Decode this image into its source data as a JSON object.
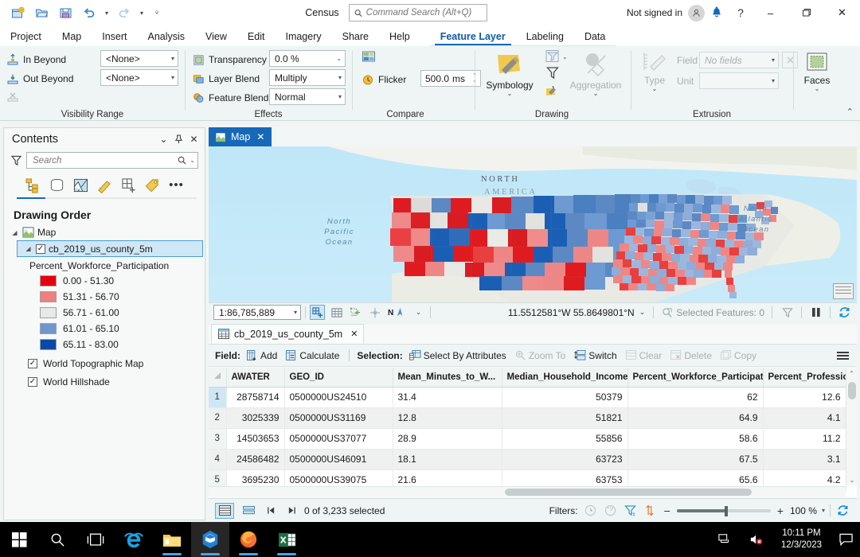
{
  "titlebar": {
    "project_name": "Census",
    "search_placeholder": "Command Search (Alt+Q)",
    "sign_in_text": "Not signed in",
    "quick_access": [
      "new-project-icon",
      "open-project-icon",
      "save-project-icon",
      "undo-icon",
      "redo-icon",
      "customize-qat-icon"
    ],
    "help_label": "?",
    "minimize_label": "–",
    "restore_label": "❐",
    "close_label": "✕"
  },
  "ribbon_tabs": {
    "main": [
      "Project",
      "Map",
      "Insert",
      "Analysis",
      "View",
      "Edit",
      "Imagery",
      "Share",
      "Help"
    ],
    "contextual": [
      "Feature Layer",
      "Labeling",
      "Data"
    ],
    "active": "Feature Layer"
  },
  "ribbon": {
    "groups": [
      {
        "name": "Visibility Range"
      },
      {
        "name": "Effects"
      },
      {
        "name": "Compare"
      },
      {
        "name": "Drawing"
      },
      {
        "name": "Extrusion"
      },
      {
        "name": ""
      }
    ],
    "visibility": {
      "in_beyond_label": "In Beyond",
      "in_beyond_value": "<None>",
      "out_beyond_label": "Out Beyond",
      "out_beyond_value": "<None>"
    },
    "effects": {
      "transparency_label": "Transparency",
      "transparency_value": "0.0 %",
      "layer_blend_label": "Layer Blend",
      "layer_blend_value": "Multiply",
      "feature_blend_label": "Feature Blend",
      "feature_blend_value": "Normal"
    },
    "compare": {
      "flicker_label": "Flicker",
      "flicker_value": "500.0",
      "flicker_unit": "ms"
    },
    "drawing": {
      "symbology_label": "Symbology",
      "aggregation_label": "Aggregation"
    },
    "extrusion": {
      "type_label": "Type",
      "field_label": "Field",
      "field_value": "No fields",
      "unit_label": "Unit",
      "unit_value": ""
    },
    "faces": {
      "label": "Faces"
    }
  },
  "contents": {
    "title": "Contents",
    "search_placeholder": "Search",
    "drawing_order_label": "Drawing Order",
    "map_node": "Map",
    "layer_name": "cb_2019_us_county_5m",
    "symbology_field": "Percent_Workforce_Participation",
    "legend": [
      {
        "label": "0.00 - 51.30",
        "color": "#e8000d"
      },
      {
        "label": "51.31 - 56.70",
        "color": "#ef8080"
      },
      {
        "label": "56.71 - 61.00",
        "color": "#e8e8e8"
      },
      {
        "label": "61.01 - 65.10",
        "color": "#6f97cd"
      },
      {
        "label": "65.11 - 83.00",
        "color": "#0b49a8"
      }
    ],
    "basemaps": [
      {
        "label": "World Topographic Map",
        "checked": true
      },
      {
        "label": "World Hillshade",
        "checked": true
      }
    ]
  },
  "map": {
    "tab_label": "Map",
    "scale": "1:86,785,889",
    "coordinates": "11.5512581°W 55.8649801°N",
    "selected_features": "Selected Features: 0",
    "labels": {
      "north_pacific": "North\nPacific\nOcean",
      "north_atlantic": "North\nAtlantic\nOcean",
      "continent": "NORTH",
      "continent2": "AMERICA"
    }
  },
  "table": {
    "tab_label": "cb_2019_us_county_5m",
    "toolbar": {
      "field_label": "Field:",
      "add_label": "Add",
      "calculate_label": "Calculate",
      "selection_label": "Selection:",
      "select_by_attributes_label": "Select By Attributes",
      "zoom_to_label": "Zoom To",
      "switch_label": "Switch",
      "clear_label": "Clear",
      "delete_label": "Delete",
      "copy_label": "Copy"
    },
    "columns": [
      "AWATER",
      "GEO_ID",
      "Mean_Minutes_to_W...",
      "Median_Household_Income",
      "Percent_Workforce_Participation",
      "Percent_Professional"
    ],
    "rows": [
      {
        "n": "1",
        "awater": "28758714",
        "geoid": "0500000US24510",
        "mean_minutes": "31.4",
        "income": "50379",
        "workforce": "62",
        "professional": "12.6"
      },
      {
        "n": "2",
        "awater": "3025339",
        "geoid": "0500000US31169",
        "mean_minutes": "12.8",
        "income": "51821",
        "workforce": "64.9",
        "professional": "4.1"
      },
      {
        "n": "3",
        "awater": "14503653",
        "geoid": "0500000US37077",
        "mean_minutes": "28.9",
        "income": "55856",
        "workforce": "58.6",
        "professional": "11.2"
      },
      {
        "n": "4",
        "awater": "24586482",
        "geoid": "0500000US46091",
        "mean_minutes": "18.1",
        "income": "63723",
        "workforce": "67.5",
        "professional": "3.1"
      },
      {
        "n": "5",
        "awater": "3695230",
        "geoid": "0500000US39075",
        "mean_minutes": "21.6",
        "income": "63753",
        "workforce": "65.6",
        "professional": "4.2"
      }
    ],
    "footer": {
      "selection_status": "0 of 3,233 selected",
      "filters_label": "Filters:",
      "zoom_percent": "100 %"
    }
  },
  "taskbar": {
    "items": [
      "start-icon",
      "search-icon",
      "task-view-icon",
      "internet-explorer-icon",
      "file-explorer-icon",
      "arcgis-pro-icon",
      "firefox-icon",
      "excel-icon"
    ],
    "time": "10:11 PM",
    "date": "12/3/2023"
  },
  "colors": {
    "accent": "#1668b8",
    "ribbon_bg": "#eef5f4",
    "selection": "#cfe7f5"
  }
}
